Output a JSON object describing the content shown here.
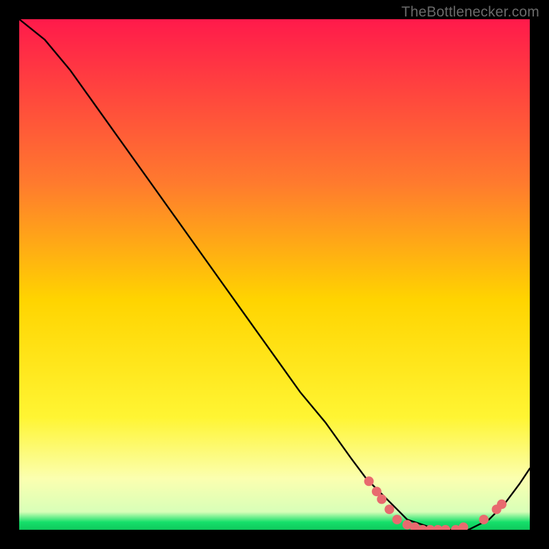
{
  "watermark": "TheBottlenecker.com",
  "gradient": {
    "top": "#ff1a4b",
    "upper_mid": "#ff7a2e",
    "mid": "#ffd400",
    "lower_mid": "#fff533",
    "pale_band": "#fbffb0",
    "green": "#15e06a"
  },
  "chart_data": {
    "type": "line",
    "title": "",
    "xlabel": "",
    "ylabel": "",
    "xlim": [
      0,
      100
    ],
    "ylim": [
      0,
      100
    ],
    "grid": false,
    "legend": false,
    "annotations": [],
    "series": [
      {
        "name": "bottleneck-curve",
        "x": [
          0,
          5,
          10,
          15,
          20,
          25,
          30,
          35,
          40,
          45,
          50,
          55,
          60,
          65,
          68,
          71,
          74,
          76,
          79,
          82,
          85,
          88,
          90,
          92,
          95,
          98,
          100
        ],
        "y": [
          100,
          96,
          90,
          83,
          76,
          69,
          62,
          55,
          48,
          41,
          34,
          27,
          21,
          14,
          10,
          7,
          4,
          2,
          1,
          0,
          0,
          0,
          1,
          2,
          5,
          9,
          12
        ]
      }
    ],
    "markers": {
      "name": "highlight-dots",
      "color": "#e86a6f",
      "points": [
        {
          "x": 68.5,
          "y": 9.5
        },
        {
          "x": 70.0,
          "y": 7.5
        },
        {
          "x": 71.0,
          "y": 6.0
        },
        {
          "x": 72.5,
          "y": 4.0
        },
        {
          "x": 74.0,
          "y": 2.0
        },
        {
          "x": 76.0,
          "y": 1.0
        },
        {
          "x": 77.5,
          "y": 0.5
        },
        {
          "x": 79.0,
          "y": 0.0
        },
        {
          "x": 80.5,
          "y": 0.0
        },
        {
          "x": 82.0,
          "y": 0.0
        },
        {
          "x": 83.5,
          "y": 0.0
        },
        {
          "x": 85.5,
          "y": 0.0
        },
        {
          "x": 87.0,
          "y": 0.5
        },
        {
          "x": 91.0,
          "y": 2.0
        },
        {
          "x": 93.5,
          "y": 4.0
        },
        {
          "x": 94.5,
          "y": 5.0
        }
      ]
    }
  }
}
